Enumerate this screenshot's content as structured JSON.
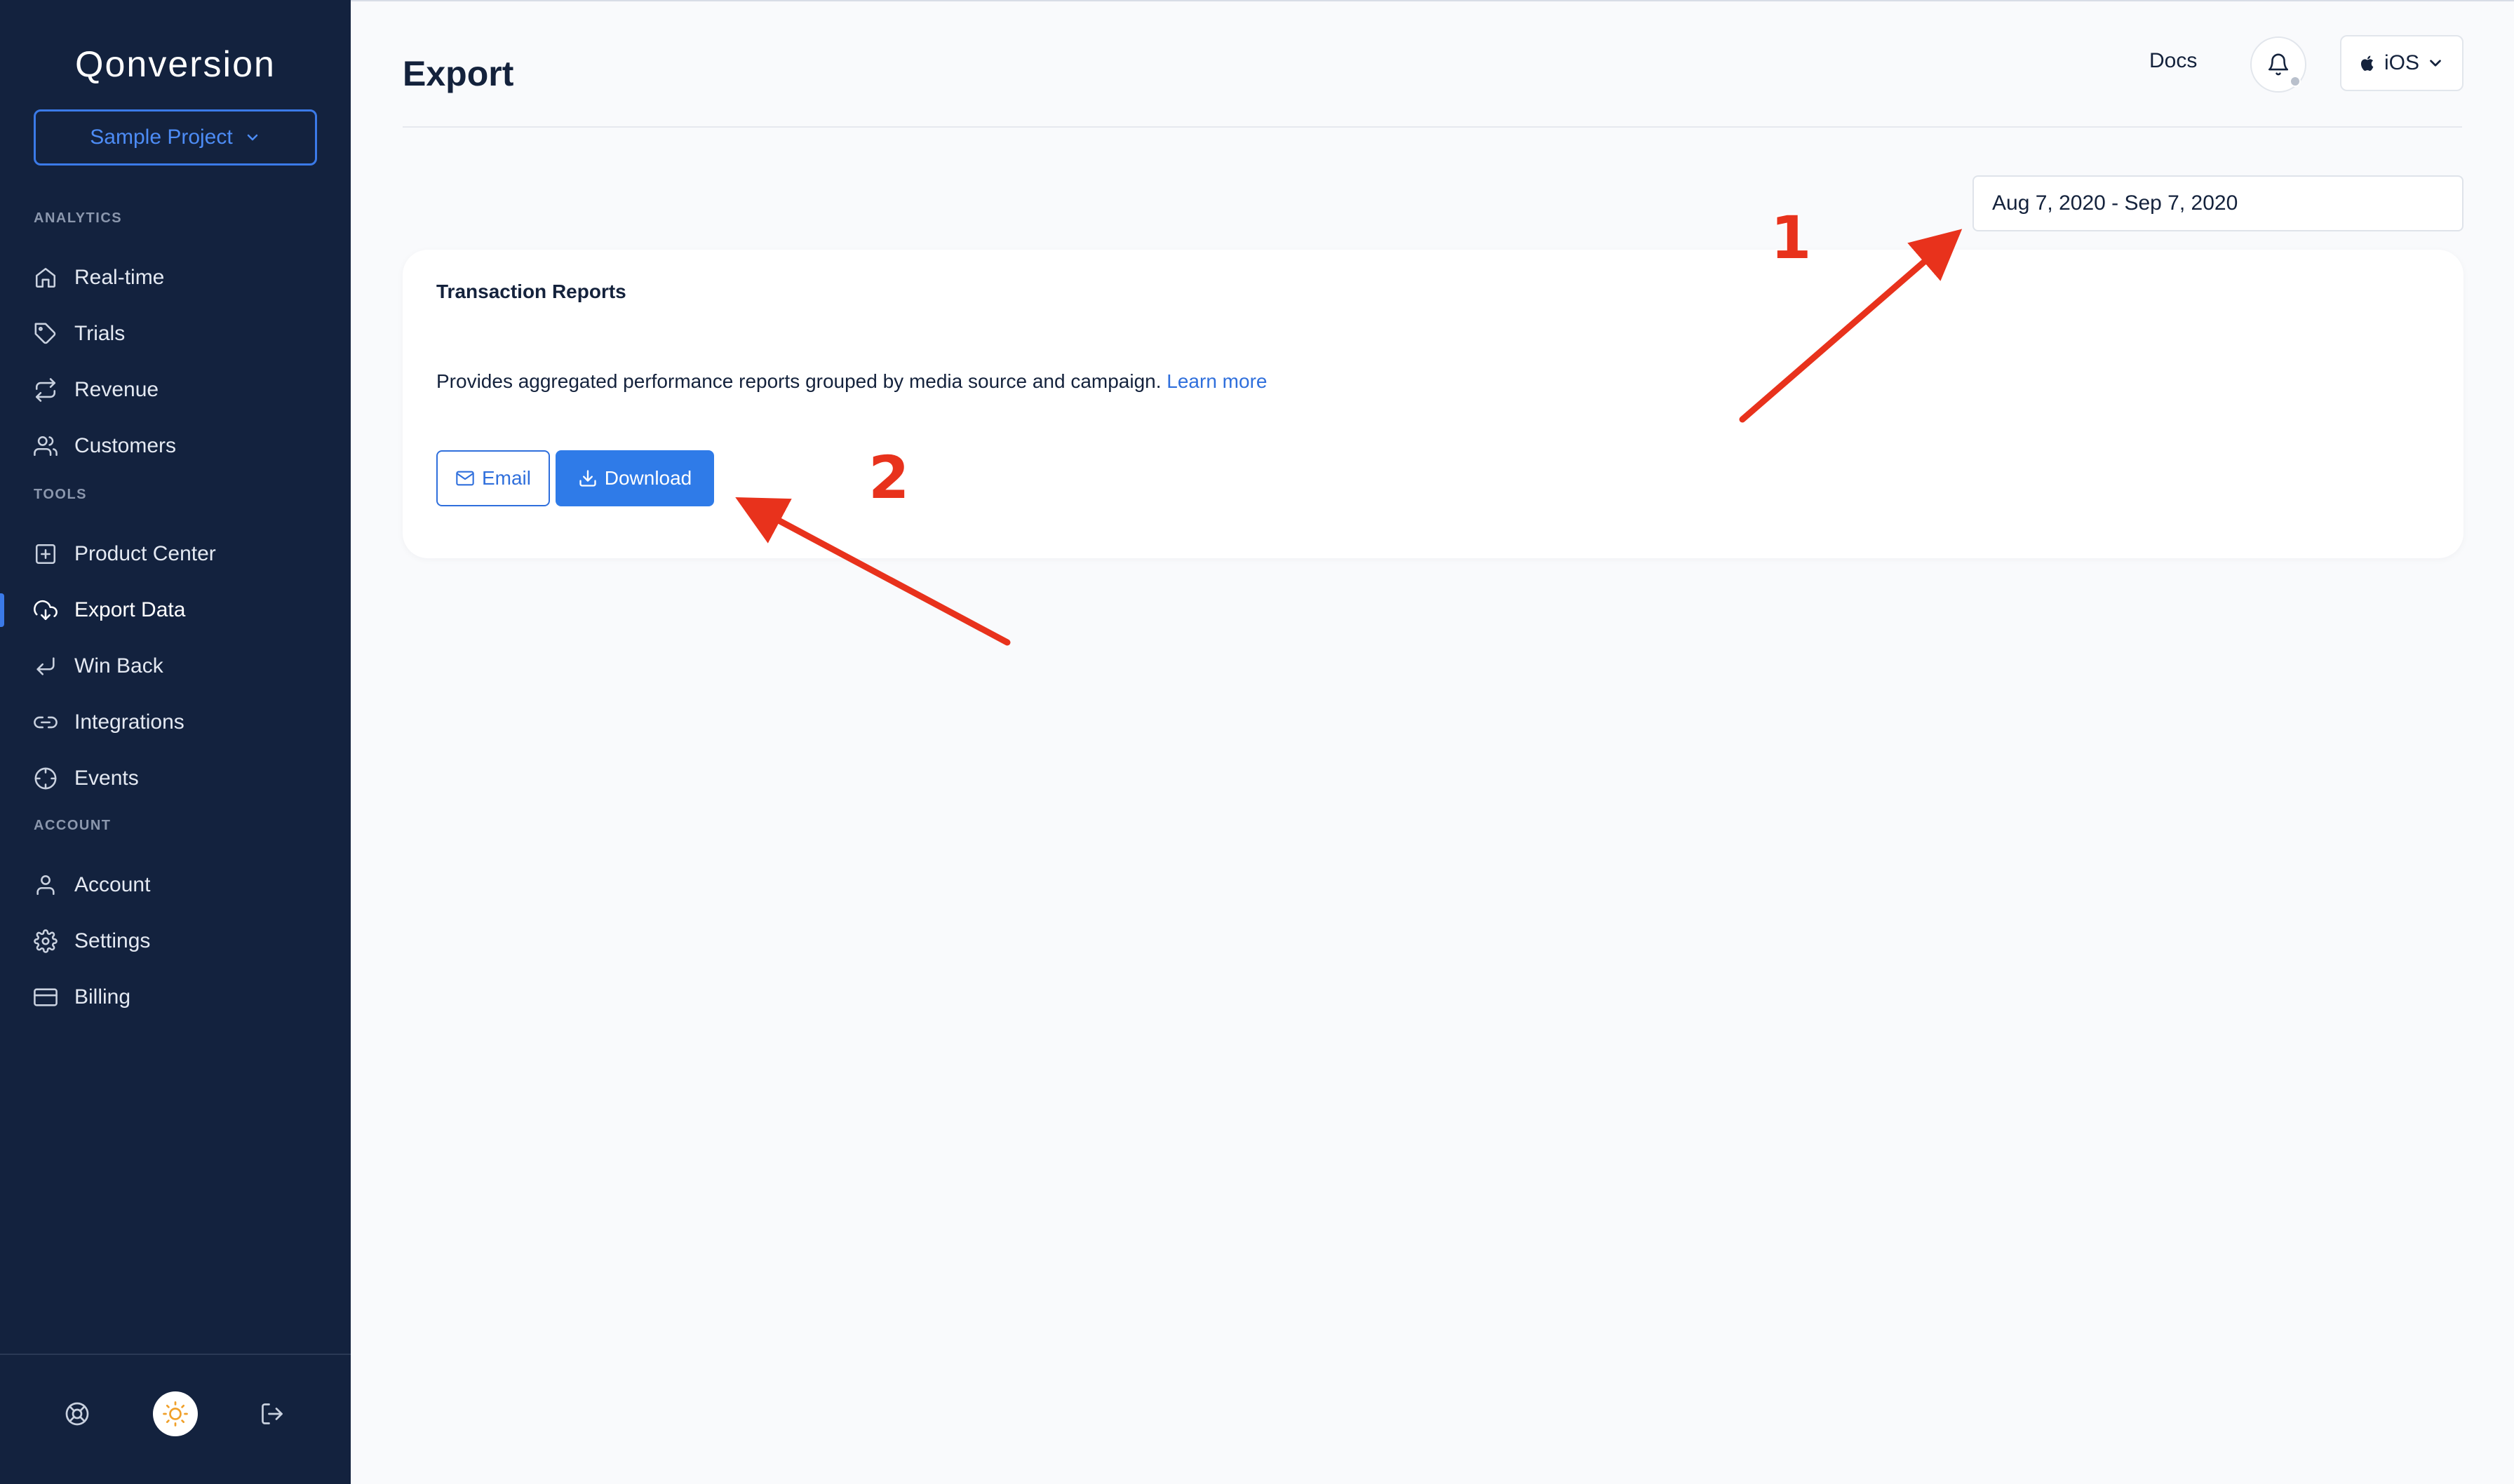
{
  "app": {
    "logo": "Qonversion",
    "project": "Sample Project"
  },
  "sidebar": {
    "sections": {
      "analytics": "ANALYTICS",
      "tools": "TOOLS",
      "account": "ACCOUNT"
    },
    "items": [
      {
        "label": "Real-time",
        "icon": "home-icon"
      },
      {
        "label": "Trials",
        "icon": "tag-icon"
      },
      {
        "label": "Revenue",
        "icon": "repeat-icon"
      },
      {
        "label": "Customers",
        "icon": "users-icon"
      },
      {
        "label": "Product Center",
        "icon": "folder-plus-icon"
      },
      {
        "label": "Export Data",
        "icon": "cloud-download-icon",
        "active": true
      },
      {
        "label": "Win Back",
        "icon": "corner-down-left-icon"
      },
      {
        "label": "Integrations",
        "icon": "link-icon"
      },
      {
        "label": "Events",
        "icon": "crosshair-icon"
      },
      {
        "label": "Account",
        "icon": "user-icon"
      },
      {
        "label": "Settings",
        "icon": "gear-icon"
      },
      {
        "label": "Billing",
        "icon": "credit-card-icon"
      }
    ],
    "footer": [
      "help-icon",
      "sun-icon",
      "logout-icon"
    ]
  },
  "header": {
    "title": "Export",
    "docs": "Docs",
    "platform": "iOS"
  },
  "filters": {
    "date_range": "Aug 7, 2020 - Sep 7, 2020"
  },
  "card": {
    "title": "Transaction Reports",
    "description": "Provides aggregated performance reports grouped by media source and campaign.",
    "learn_more": "Learn more",
    "email_label": "Email",
    "download_label": "Download"
  },
  "annotations": {
    "step1": "1",
    "step2": "2",
    "color": "#e8321c"
  },
  "colors": {
    "sidebar_bg": "#13223e",
    "accent": "#2f7be8",
    "page_bg": "#f9fafc"
  }
}
